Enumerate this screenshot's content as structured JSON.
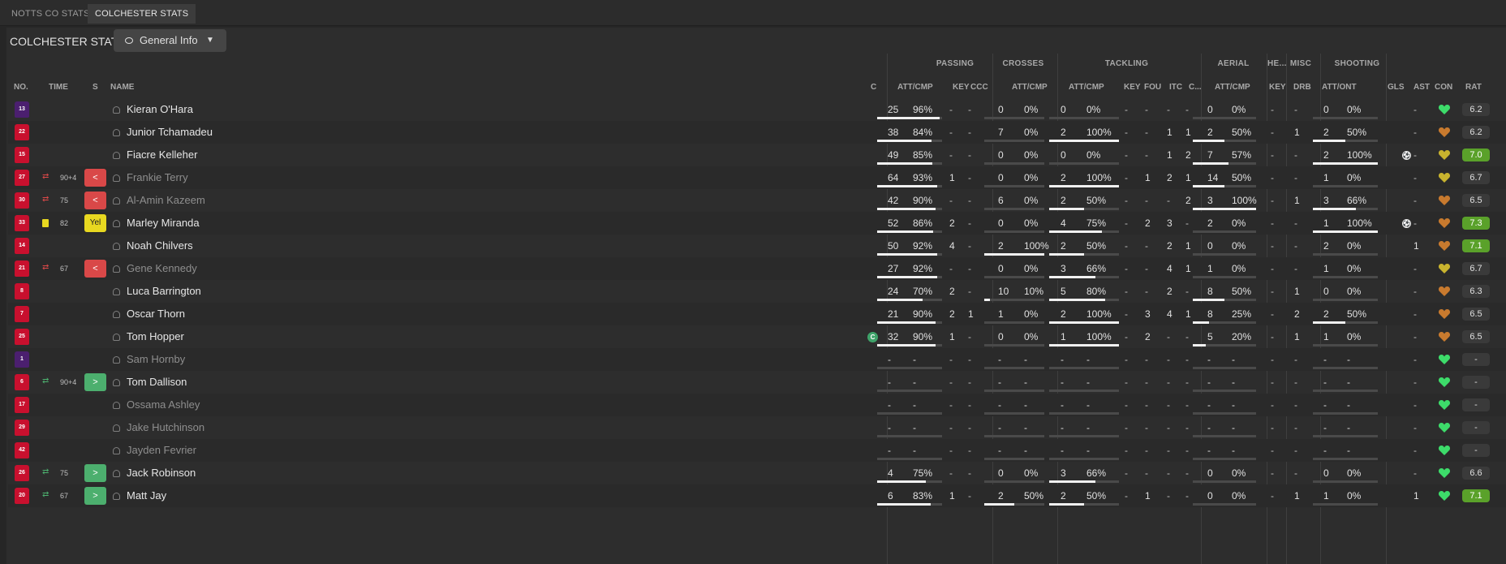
{
  "tabs": [
    {
      "label": "NOTTS CO STATS",
      "active": false
    },
    {
      "label": "COLCHESTER STATS",
      "active": true
    }
  ],
  "panel_title": "COLCHESTER STATS",
  "view_dropdown": {
    "label": "General Info"
  },
  "groups": [
    "PASSING",
    "CROSSES",
    "TACKLING",
    "AERIAL",
    "HE...",
    "MISC",
    "SHOOTING"
  ],
  "columns": [
    "NO.",
    "TIME",
    "S",
    "NAME",
    "C",
    "ATT/CMP",
    "KEY",
    "CCC",
    "ATT/CMP",
    "ATT/CMP",
    "KEY",
    "FOU",
    "ITC",
    "C...",
    "ATT/CMP",
    "KEY",
    "DRB",
    "ATT/ONT",
    "GLS",
    "AST",
    "CON",
    "RAT"
  ],
  "colors": {
    "red_kit": "#c8102e",
    "purple_kit": "#4b1f6f",
    "sub_off": "#d94848",
    "sub_on": "#4caf6e",
    "yellow": "#e8d820",
    "rating_high": "#5aa12a",
    "condition_green": "#3ddc6a",
    "condition_orange": "#c87a2e"
  },
  "players": [
    {
      "no": "13",
      "kit": "purple",
      "sub": "",
      "mins": "",
      "badge": "",
      "badge_text": "",
      "name": "Kieran O'Hara",
      "dim": false,
      "captain": false,
      "pass": [
        "25",
        "96%",
        0.96
      ],
      "pkey": "-",
      "ccc": "-",
      "cross": [
        "0",
        "0%",
        0
      ],
      "tack": [
        "0",
        "0%",
        0
      ],
      "tkey": "-",
      "fou": "-",
      "itc": "-",
      "c": "-",
      "aer": [
        "0",
        "0%",
        0
      ],
      "hkey": "-",
      "drb": "-",
      "shot": [
        "0",
        "0%",
        0
      ],
      "gls": "",
      "ast": "-",
      "con": "green",
      "rat": "6.2",
      "rat_hi": false
    },
    {
      "no": "22",
      "kit": "red",
      "sub": "",
      "mins": "",
      "badge": "",
      "badge_text": "",
      "name": "Junior Tchamadeu",
      "dim": false,
      "captain": false,
      "pass": [
        "38",
        "84%",
        0.84
      ],
      "pkey": "-",
      "ccc": "-",
      "cross": [
        "7",
        "0%",
        0
      ],
      "tack": [
        "2",
        "100%",
        1
      ],
      "tkey": "-",
      "fou": "-",
      "itc": "1",
      "c": "1",
      "aer": [
        "2",
        "50%",
        0.5
      ],
      "hkey": "-",
      "drb": "1",
      "shot": [
        "2",
        "50%",
        0.5
      ],
      "gls": "",
      "ast": "-",
      "con": "orange",
      "rat": "6.2",
      "rat_hi": false
    },
    {
      "no": "15",
      "kit": "red",
      "sub": "",
      "mins": "",
      "badge": "",
      "badge_text": "",
      "name": "Fiacre Kelleher",
      "dim": false,
      "captain": false,
      "pass": [
        "49",
        "85%",
        0.85
      ],
      "pkey": "-",
      "ccc": "-",
      "cross": [
        "0",
        "0%",
        0
      ],
      "tack": [
        "0",
        "0%",
        0
      ],
      "tkey": "-",
      "fou": "-",
      "itc": "1",
      "c": "2",
      "aer": [
        "7",
        "57%",
        0.57
      ],
      "hkey": "-",
      "drb": "-",
      "shot": [
        "2",
        "100%",
        1
      ],
      "gls": "goal",
      "ast": "-",
      "con": "yellow",
      "rat": "7.0",
      "rat_hi": true
    },
    {
      "no": "27",
      "kit": "red",
      "sub": "off",
      "mins": "90+4",
      "badge": "off",
      "badge_text": "<",
      "name": "Frankie Terry",
      "dim": true,
      "captain": false,
      "pass": [
        "64",
        "93%",
        0.93
      ],
      "pkey": "1",
      "ccc": "-",
      "cross": [
        "0",
        "0%",
        0
      ],
      "tack": [
        "2",
        "100%",
        1
      ],
      "tkey": "-",
      "fou": "1",
      "itc": "2",
      "c": "1",
      "aer": [
        "14",
        "50%",
        0.5
      ],
      "hkey": "-",
      "drb": "-",
      "shot": [
        "1",
        "0%",
        0
      ],
      "gls": "",
      "ast": "-",
      "con": "yellow",
      "rat": "6.7",
      "rat_hi": false
    },
    {
      "no": "30",
      "kit": "red",
      "sub": "off",
      "mins": "75",
      "badge": "off",
      "badge_text": "<",
      "name": "Al-Amin Kazeem",
      "dim": true,
      "captain": false,
      "pass": [
        "42",
        "90%",
        0.9
      ],
      "pkey": "-",
      "ccc": "-",
      "cross": [
        "6",
        "0%",
        0
      ],
      "tack": [
        "2",
        "50%",
        0.5
      ],
      "tkey": "-",
      "fou": "-",
      "itc": "-",
      "c": "2",
      "aer": [
        "3",
        "100%",
        1
      ],
      "hkey": "-",
      "drb": "1",
      "shot": [
        "3",
        "66%",
        0.66
      ],
      "gls": "",
      "ast": "-",
      "con": "orange",
      "rat": "6.5",
      "rat_hi": false
    },
    {
      "no": "33",
      "kit": "red",
      "sub": "card",
      "mins": "82",
      "badge": "yel",
      "badge_text": "Yel",
      "name": "Marley Miranda",
      "dim": false,
      "captain": false,
      "pass": [
        "52",
        "86%",
        0.86
      ],
      "pkey": "2",
      "ccc": "-",
      "cross": [
        "0",
        "0%",
        0
      ],
      "tack": [
        "4",
        "75%",
        0.75
      ],
      "tkey": "-",
      "fou": "2",
      "itc": "3",
      "c": "-",
      "aer": [
        "2",
        "0%",
        0
      ],
      "hkey": "-",
      "drb": "-",
      "shot": [
        "1",
        "100%",
        1
      ],
      "gls": "goal",
      "ast": "-",
      "con": "orange",
      "rat": "7.3",
      "rat_hi": true
    },
    {
      "no": "14",
      "kit": "red",
      "sub": "",
      "mins": "",
      "badge": "",
      "badge_text": "",
      "name": "Noah Chilvers",
      "dim": false,
      "captain": false,
      "pass": [
        "50",
        "92%",
        0.92
      ],
      "pkey": "4",
      "ccc": "-",
      "cross": [
        "2",
        "100%",
        1
      ],
      "tack": [
        "2",
        "50%",
        0.5
      ],
      "tkey": "-",
      "fou": "-",
      "itc": "2",
      "c": "1",
      "aer": [
        "0",
        "0%",
        0
      ],
      "hkey": "-",
      "drb": "-",
      "shot": [
        "2",
        "0%",
        0
      ],
      "gls": "",
      "ast": "1",
      "con": "orange",
      "rat": "7.1",
      "rat_hi": true
    },
    {
      "no": "21",
      "kit": "red",
      "sub": "off",
      "mins": "67",
      "badge": "off",
      "badge_text": "<",
      "name": "Gene Kennedy",
      "dim": true,
      "captain": false,
      "pass": [
        "27",
        "92%",
        0.92
      ],
      "pkey": "-",
      "ccc": "-",
      "cross": [
        "0",
        "0%",
        0
      ],
      "tack": [
        "3",
        "66%",
        0.66
      ],
      "tkey": "-",
      "fou": "-",
      "itc": "4",
      "c": "1",
      "aer": [
        "1",
        "0%",
        0
      ],
      "hkey": "-",
      "drb": "-",
      "shot": [
        "1",
        "0%",
        0
      ],
      "gls": "",
      "ast": "-",
      "con": "yellow",
      "rat": "6.7",
      "rat_hi": false
    },
    {
      "no": "8",
      "kit": "red",
      "sub": "",
      "mins": "",
      "badge": "",
      "badge_text": "",
      "name": "Luca Barrington",
      "dim": false,
      "captain": false,
      "pass": [
        "24",
        "70%",
        0.7
      ],
      "pkey": "2",
      "ccc": "-",
      "cross": [
        "10",
        "10%",
        0.1
      ],
      "tack": [
        "5",
        "80%",
        0.8
      ],
      "tkey": "-",
      "fou": "-",
      "itc": "2",
      "c": "-",
      "aer": [
        "8",
        "50%",
        0.5
      ],
      "hkey": "-",
      "drb": "1",
      "shot": [
        "0",
        "0%",
        0
      ],
      "gls": "",
      "ast": "-",
      "con": "orange",
      "rat": "6.3",
      "rat_hi": false
    },
    {
      "no": "7",
      "kit": "red",
      "sub": "",
      "mins": "",
      "badge": "",
      "badge_text": "",
      "name": "Oscar Thorn",
      "dim": false,
      "captain": false,
      "pass": [
        "21",
        "90%",
        0.9
      ],
      "pkey": "2",
      "ccc": "1",
      "cross": [
        "1",
        "0%",
        0
      ],
      "tack": [
        "2",
        "100%",
        1
      ],
      "tkey": "-",
      "fou": "3",
      "itc": "4",
      "c": "1",
      "aer": [
        "8",
        "25%",
        0.25
      ],
      "hkey": "-",
      "drb": "2",
      "shot": [
        "2",
        "50%",
        0.5
      ],
      "gls": "",
      "ast": "-",
      "con": "orange",
      "rat": "6.5",
      "rat_hi": false
    },
    {
      "no": "25",
      "kit": "red",
      "sub": "",
      "mins": "",
      "badge": "",
      "badge_text": "",
      "name": "Tom Hopper",
      "dim": false,
      "captain": true,
      "pass": [
        "32",
        "90%",
        0.9
      ],
      "pkey": "1",
      "ccc": "-",
      "cross": [
        "0",
        "0%",
        0
      ],
      "tack": [
        "1",
        "100%",
        1
      ],
      "tkey": "-",
      "fou": "2",
      "itc": "-",
      "c": "-",
      "aer": [
        "5",
        "20%",
        0.2
      ],
      "hkey": "-",
      "drb": "1",
      "shot": [
        "1",
        "0%",
        0
      ],
      "gls": "",
      "ast": "-",
      "con": "orange",
      "rat": "6.5",
      "rat_hi": false
    },
    {
      "no": "1",
      "kit": "purple",
      "sub": "",
      "mins": "",
      "badge": "",
      "badge_text": "",
      "name": "Sam Hornby",
      "dim": true,
      "captain": false,
      "pass": [
        "-",
        "-",
        0
      ],
      "pkey": "-",
      "ccc": "-",
      "cross": [
        "-",
        "-",
        0
      ],
      "tack": [
        "-",
        "-",
        0
      ],
      "tkey": "-",
      "fou": "-",
      "itc": "-",
      "c": "-",
      "aer": [
        "-",
        "-",
        0
      ],
      "hkey": "-",
      "drb": "-",
      "shot": [
        "-",
        "-",
        0
      ],
      "gls": "",
      "ast": "-",
      "con": "green",
      "rat": "-",
      "rat_hi": false
    },
    {
      "no": "6",
      "kit": "red",
      "sub": "on",
      "mins": "90+4",
      "badge": "on",
      "badge_text": ">",
      "name": "Tom Dallison",
      "dim": false,
      "captain": false,
      "pass": [
        "-",
        "-",
        0
      ],
      "pkey": "-",
      "ccc": "-",
      "cross": [
        "-",
        "-",
        0
      ],
      "tack": [
        "-",
        "-",
        0
      ],
      "tkey": "-",
      "fou": "-",
      "itc": "-",
      "c": "-",
      "aer": [
        "-",
        "-",
        0
      ],
      "hkey": "-",
      "drb": "-",
      "shot": [
        "-",
        "-",
        0
      ],
      "gls": "",
      "ast": "-",
      "con": "green",
      "rat": "-",
      "rat_hi": false
    },
    {
      "no": "17",
      "kit": "red",
      "sub": "",
      "mins": "",
      "badge": "",
      "badge_text": "",
      "name": "Ossama Ashley",
      "dim": true,
      "captain": false,
      "pass": [
        "-",
        "-",
        0
      ],
      "pkey": "-",
      "ccc": "-",
      "cross": [
        "-",
        "-",
        0
      ],
      "tack": [
        "-",
        "-",
        0
      ],
      "tkey": "-",
      "fou": "-",
      "itc": "-",
      "c": "-",
      "aer": [
        "-",
        "-",
        0
      ],
      "hkey": "-",
      "drb": "-",
      "shot": [
        "-",
        "-",
        0
      ],
      "gls": "",
      "ast": "-",
      "con": "green",
      "rat": "-",
      "rat_hi": false
    },
    {
      "no": "29",
      "kit": "red",
      "sub": "",
      "mins": "",
      "badge": "",
      "badge_text": "",
      "name": "Jake Hutchinson",
      "dim": true,
      "captain": false,
      "pass": [
        "-",
        "-",
        0
      ],
      "pkey": "-",
      "ccc": "-",
      "cross": [
        "-",
        "-",
        0
      ],
      "tack": [
        "-",
        "-",
        0
      ],
      "tkey": "-",
      "fou": "-",
      "itc": "-",
      "c": "-",
      "aer": [
        "-",
        "-",
        0
      ],
      "hkey": "-",
      "drb": "-",
      "shot": [
        "-",
        "-",
        0
      ],
      "gls": "",
      "ast": "-",
      "con": "green",
      "rat": "-",
      "rat_hi": false
    },
    {
      "no": "42",
      "kit": "red",
      "sub": "",
      "mins": "",
      "badge": "",
      "badge_text": "",
      "name": "Jayden Fevrier",
      "dim": true,
      "captain": false,
      "pass": [
        "-",
        "-",
        0
      ],
      "pkey": "-",
      "ccc": "-",
      "cross": [
        "-",
        "-",
        0
      ],
      "tack": [
        "-",
        "-",
        0
      ],
      "tkey": "-",
      "fou": "-",
      "itc": "-",
      "c": "-",
      "aer": [
        "-",
        "-",
        0
      ],
      "hkey": "-",
      "drb": "-",
      "shot": [
        "-",
        "-",
        0
      ],
      "gls": "",
      "ast": "-",
      "con": "green",
      "rat": "-",
      "rat_hi": false
    },
    {
      "no": "26",
      "kit": "red",
      "sub": "on",
      "mins": "75",
      "badge": "on",
      "badge_text": ">",
      "name": "Jack Robinson",
      "dim": false,
      "captain": false,
      "pass": [
        "4",
        "75%",
        0.75
      ],
      "pkey": "-",
      "ccc": "-",
      "cross": [
        "0",
        "0%",
        0
      ],
      "tack": [
        "3",
        "66%",
        0.66
      ],
      "tkey": "-",
      "fou": "-",
      "itc": "-",
      "c": "-",
      "aer": [
        "0",
        "0%",
        0
      ],
      "hkey": "-",
      "drb": "-",
      "shot": [
        "0",
        "0%",
        0
      ],
      "gls": "",
      "ast": "-",
      "con": "green",
      "rat": "6.6",
      "rat_hi": false
    },
    {
      "no": "20",
      "kit": "red",
      "sub": "on",
      "mins": "67",
      "badge": "on",
      "badge_text": ">",
      "name": "Matt Jay",
      "dim": false,
      "captain": false,
      "pass": [
        "6",
        "83%",
        0.83
      ],
      "pkey": "1",
      "ccc": "-",
      "cross": [
        "2",
        "50%",
        0.5
      ],
      "tack": [
        "2",
        "50%",
        0.5
      ],
      "tkey": "-",
      "fou": "1",
      "itc": "-",
      "c": "-",
      "aer": [
        "0",
        "0%",
        0
      ],
      "hkey": "-",
      "drb": "1",
      "shot": [
        "1",
        "0%",
        0
      ],
      "gls": "",
      "ast": "1",
      "con": "green",
      "rat": "7.1",
      "rat_hi": true
    }
  ]
}
